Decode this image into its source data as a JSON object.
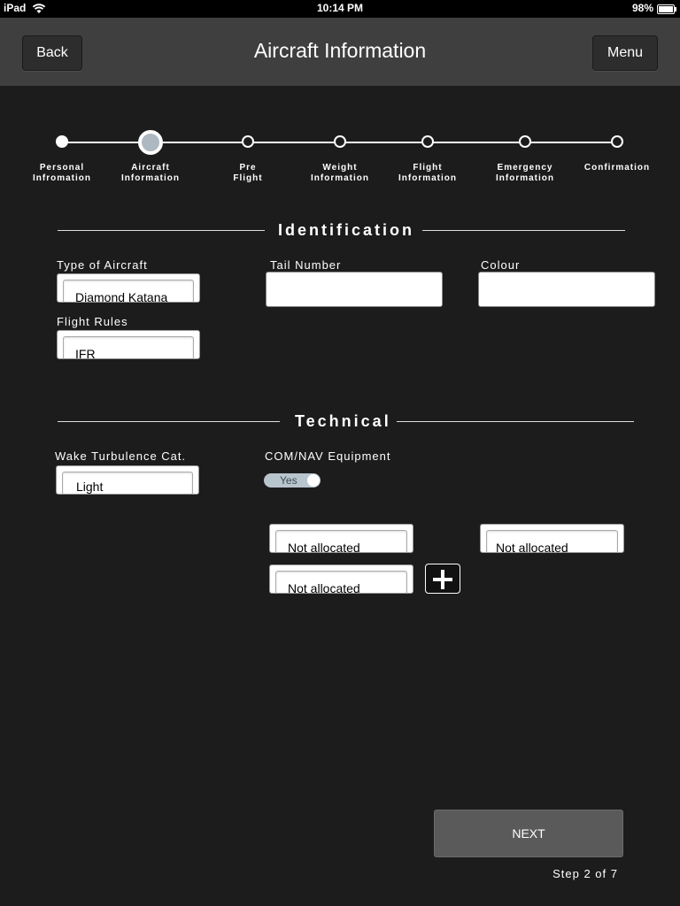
{
  "status_bar": {
    "carrier": "iPad",
    "wifi_icon": "wifi-icon",
    "time": "10:14 PM",
    "battery": "98%",
    "battery_level": 0.98
  },
  "header": {
    "title": "Aircraft Information",
    "back_label": "Back",
    "menu_label": "Menu",
    "background": "#3f3f3f"
  },
  "stepper": {
    "current_index": 1,
    "steps": [
      {
        "label_line1": "Personal",
        "label_line2": "Infromation"
      },
      {
        "label_line1": "Aircraft",
        "label_line2": "Information"
      },
      {
        "label_line1": "Pre",
        "label_line2": "Flight"
      },
      {
        "label_line1": "Weight",
        "label_line2": "Information"
      },
      {
        "label_line1": "Flight",
        "label_line2": "Information"
      },
      {
        "label_line1": "Emergency",
        "label_line2": "Information"
      },
      {
        "label_line1": "Confirmation",
        "label_line2": ""
      }
    ]
  },
  "identification": {
    "heading": "Identification",
    "type_of_aircraft": {
      "label": "Type of Aircraft",
      "value": "Diamond Katana"
    },
    "tail_number": {
      "label": "Tail Number",
      "value": ""
    },
    "colour": {
      "label": "Colour",
      "value": ""
    },
    "flight_rules": {
      "label": "Flight Rules",
      "value": "IFR"
    }
  },
  "technical": {
    "heading": "Technical",
    "wake_turbulence": {
      "label": "Wake Turbulence Cat.",
      "value": "Light"
    },
    "com_nav": {
      "label": "COM/NAV Equipment",
      "toggle_label": "Yes",
      "toggle_on": true,
      "slots": [
        "Not allocated",
        "Not allocated",
        "Not allocated"
      ],
      "add_icon": "plus-icon"
    }
  },
  "footer": {
    "next_label": "NEXT",
    "step_text": "Step 2 of 7"
  }
}
